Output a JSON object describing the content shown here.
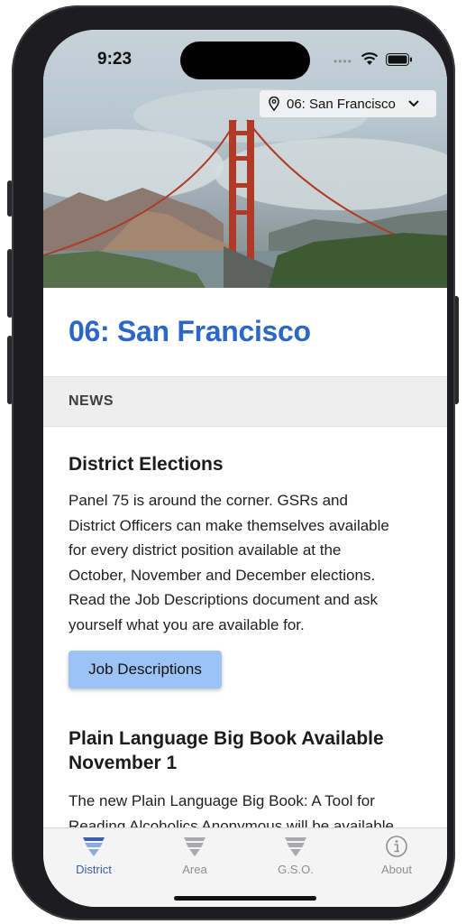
{
  "status": {
    "time": "9:23"
  },
  "district_selector": {
    "label": "06: San Francisco"
  },
  "page": {
    "title": "06: San Francisco"
  },
  "section": {
    "label": "NEWS"
  },
  "articles": [
    {
      "title": "District Elections",
      "body_lines": [
        "Panel 75 is around the corner.  GSRs and",
        "District Officers can make themselves available",
        "for every district position available at the",
        "October, November and December elections.",
        "Read the Job Descriptions document and ask",
        "yourself what you are available for."
      ],
      "button_label": "Job Descriptions"
    },
    {
      "title_lines": [
        "Plain Language Big Book Available",
        "November 1"
      ],
      "body_lines": [
        "The new Plain Language Big Book: A Tool for",
        "Reading Alcoholics Anonymous will be available"
      ]
    }
  ],
  "tabs": [
    {
      "label": "District",
      "icon": "triangle-stack-icon",
      "active": true
    },
    {
      "label": "Area",
      "icon": "triangle-stack-icon",
      "active": false
    },
    {
      "label": "G.S.O.",
      "icon": "triangle-stack-icon",
      "active": false
    },
    {
      "label": "About",
      "icon": "info-circle-icon",
      "active": false
    }
  ],
  "colors": {
    "title_blue": "#2b67c6",
    "button_blue": "#9cc3f5",
    "active_tab": "#3b5ea8",
    "inactive_tab": "#8e8e93"
  }
}
